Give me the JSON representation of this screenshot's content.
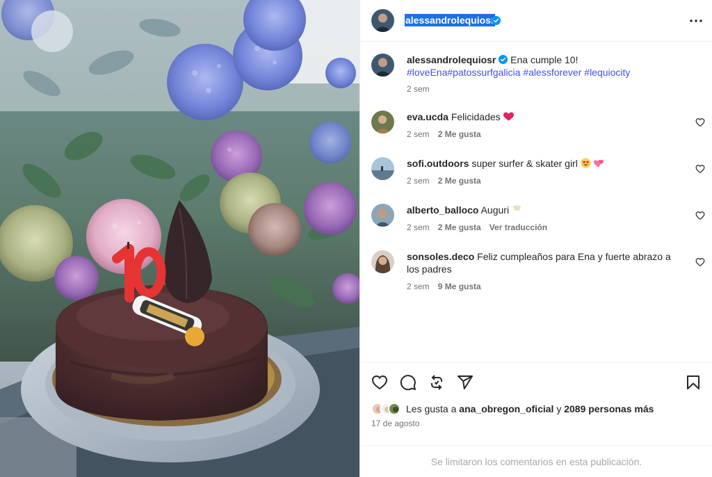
{
  "post": {
    "owner": "alessandrolequiosr",
    "caption_text": "Ena cumple 10!",
    "caption_tags": [
      "#loveEna",
      "#patossurfgalicia",
      "#alessforever",
      "#lequiocity"
    ],
    "caption_time": "2 sem"
  },
  "comments": [
    {
      "user": "eva.ucda",
      "text": "Felicidades",
      "emoji": "heart-emoji",
      "time": "2 sem",
      "likes": "2 Me gusta",
      "extra": ""
    },
    {
      "user": "sofi.outdoors",
      "text": "super surfer & skater girl",
      "emoji": "heart-eyes-and-hearts-emoji",
      "time": "2 sem",
      "likes": "2 Me gusta",
      "extra": ""
    },
    {
      "user": "alberto_balloco",
      "text": "Auguri",
      "emoji": "clinking-glasses-emoji",
      "time": "2 sem",
      "likes": "2 Me gusta",
      "extra": "Ver traducción"
    },
    {
      "user": "sonsoles.deco",
      "text": "Feliz cumpleaños para Ena y fuerte abrazo a los padres",
      "emoji": "",
      "time": "2 sem",
      "likes": "9 Me gusta",
      "extra": ""
    }
  ],
  "likes": {
    "prefix": "Les gusta a",
    "first_user": "ana_obregon_oficial",
    "joiner": "y",
    "others": "2089 personas más"
  },
  "date": "17 de agosto",
  "footer_text": "Se limitaron los comentarios en esta publicación.",
  "icons": [
    "verified-icon",
    "more-options-icon",
    "heart-icon",
    "comment-icon",
    "repost-icon",
    "share-icon",
    "bookmark-icon"
  ],
  "colors": {
    "link": "#4150f7",
    "verified": "#0095f6",
    "muted": "#737373",
    "heart_emoji": "#e0245e"
  }
}
